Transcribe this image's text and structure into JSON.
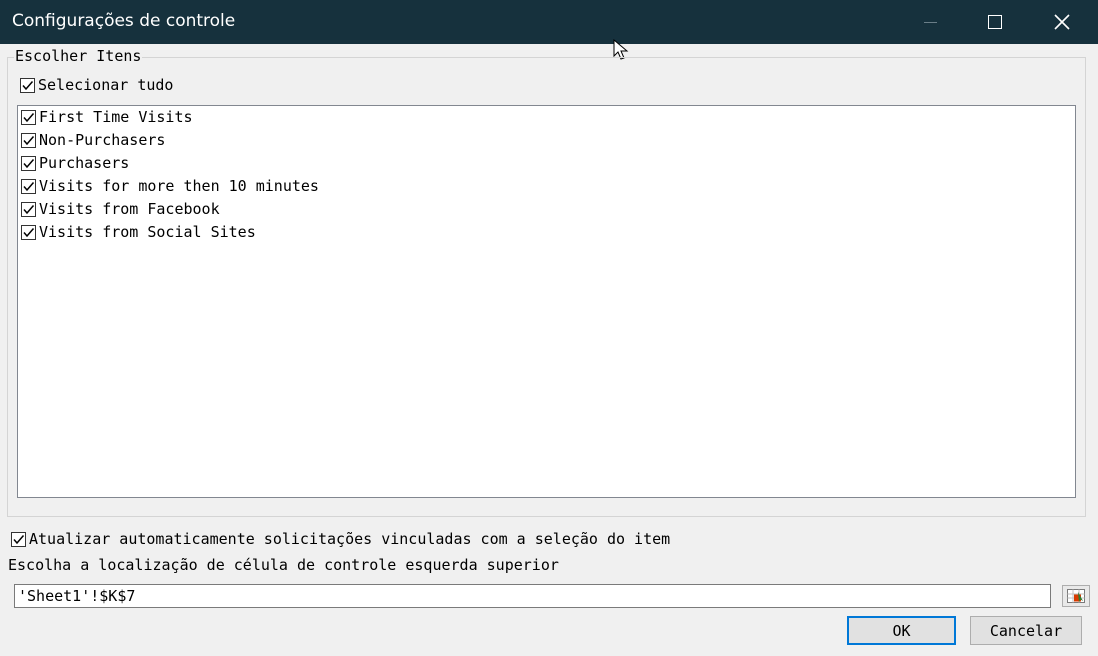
{
  "window": {
    "title": "Configurações de controle"
  },
  "group": {
    "legend": "Escolher Itens",
    "select_all": {
      "label": "Selecionar tudo",
      "checked": true
    },
    "items": [
      {
        "label": "First Time Visits",
        "checked": true
      },
      {
        "label": "Non-Purchasers",
        "checked": true
      },
      {
        "label": "Purchasers",
        "checked": true
      },
      {
        "label": "Visits for more then 10 minutes",
        "checked": true
      },
      {
        "label": "Visits from Facebook",
        "checked": true
      },
      {
        "label": "Visits from Social Sites",
        "checked": true
      }
    ]
  },
  "auto_update": {
    "label": "Atualizar automaticamente solicitações vinculadas com a seleção do item",
    "checked": true
  },
  "location": {
    "label": "Escolha a localização de célula de controle esquerda superior",
    "value": "'Sheet1'!$K$7"
  },
  "buttons": {
    "ok": "OK",
    "cancel": "Cancelar"
  }
}
